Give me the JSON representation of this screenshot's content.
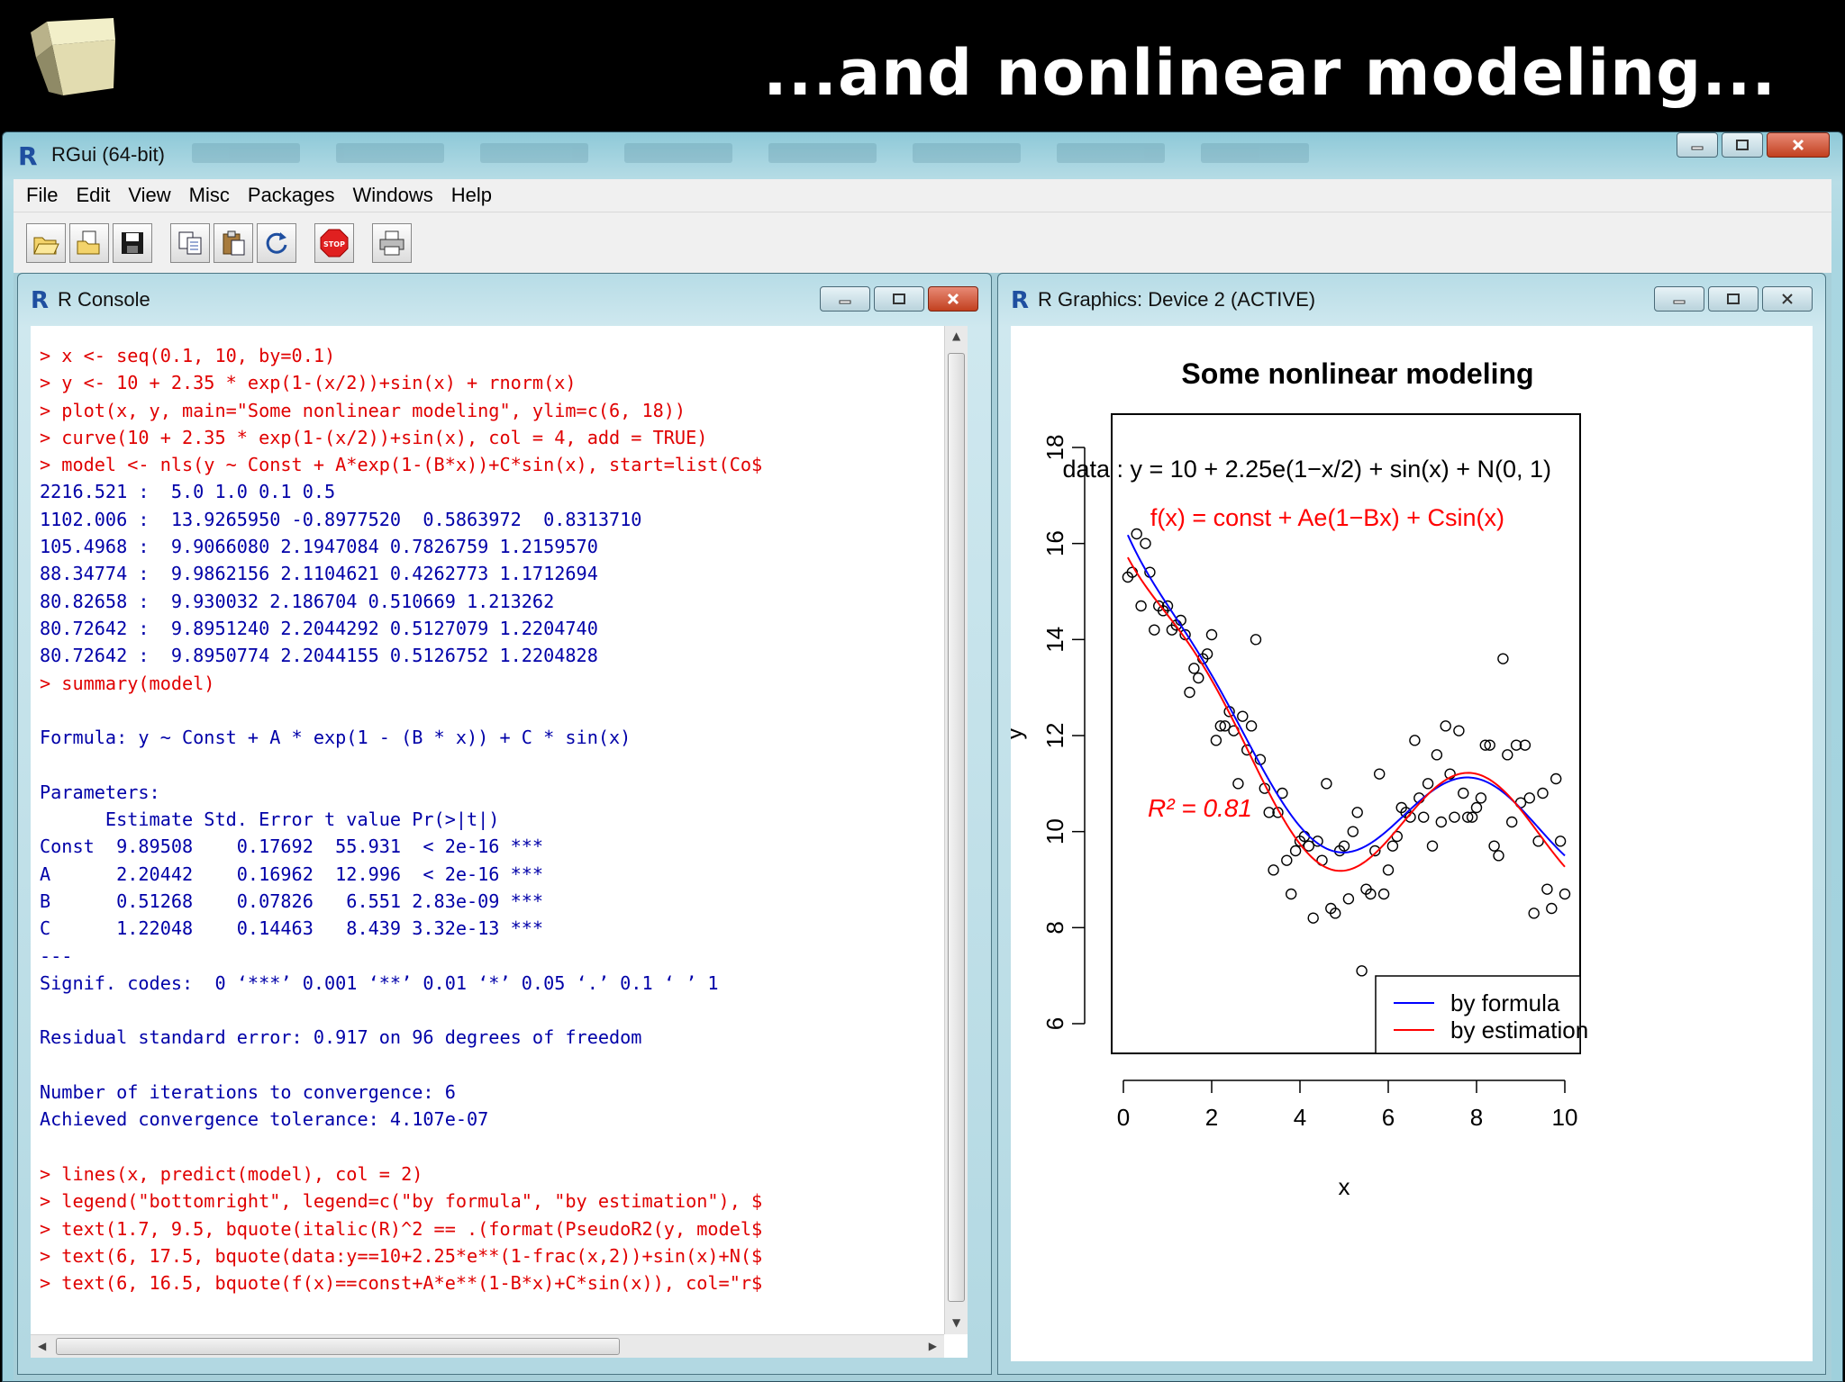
{
  "slide": {
    "title": "...and nonlinear modeling..."
  },
  "window": {
    "title": "RGui (64-bit)",
    "menu": [
      "File",
      "Edit",
      "View",
      "Misc",
      "Packages",
      "Windows",
      "Help"
    ],
    "toolbar_icons": [
      "open-script-icon",
      "load-workspace-icon",
      "save-icon",
      "copy-icon",
      "paste-icon",
      "refresh-icon",
      "stop-icon",
      "print-icon"
    ],
    "toolbar_stop_label": "STOP"
  },
  "console": {
    "title": "R Console",
    "lines": [
      {
        "kind": "cmd",
        "text": "> x <- seq(0.1, 10, by=0.1)"
      },
      {
        "kind": "cmd",
        "text": "> y <- 10 + 2.35 * exp(1-(x/2))+sin(x) + rnorm(x)"
      },
      {
        "kind": "cmd",
        "text": "> plot(x, y, main=\"Some nonlinear modeling\", ylim=c(6, 18))"
      },
      {
        "kind": "cmd",
        "text": "> curve(10 + 2.35 * exp(1-(x/2))+sin(x), col = 4, add = TRUE)"
      },
      {
        "kind": "cmd",
        "text": "> model <- nls(y ~ Const + A*exp(1-(B*x))+C*sin(x), start=list(Co$"
      },
      {
        "kind": "out",
        "text": "2216.521 :  5.0 1.0 0.1 0.5"
      },
      {
        "kind": "out",
        "text": "1102.006 :  13.9265950 -0.8977520  0.5863972  0.8313710"
      },
      {
        "kind": "out",
        "text": "105.4968 :  9.9066080 2.1947084 0.7826759 1.2159570"
      },
      {
        "kind": "out",
        "text": "88.34774 :  9.9862156 2.1104621 0.4262773 1.1712694"
      },
      {
        "kind": "out",
        "text": "80.82658 :  9.930032 2.186704 0.510669 1.213262"
      },
      {
        "kind": "out",
        "text": "80.72642 :  9.8951240 2.2044292 0.5127079 1.2204740"
      },
      {
        "kind": "out",
        "text": "80.72642 :  9.8950774 2.2044155 0.5126752 1.2204828"
      },
      {
        "kind": "cmd",
        "text": "> summary(model)"
      },
      {
        "kind": "out",
        "text": ""
      },
      {
        "kind": "out",
        "text": "Formula: y ~ Const + A * exp(1 - (B * x)) + C * sin(x)"
      },
      {
        "kind": "out",
        "text": ""
      },
      {
        "kind": "out",
        "text": "Parameters:"
      },
      {
        "kind": "out",
        "text": "      Estimate Std. Error t value Pr(>|t|)    "
      },
      {
        "kind": "out",
        "text": "Const  9.89508    0.17692  55.931  < 2e-16 ***"
      },
      {
        "kind": "out",
        "text": "A      2.20442    0.16962  12.996  < 2e-16 ***"
      },
      {
        "kind": "out",
        "text": "B      0.51268    0.07826   6.551 2.83e-09 ***"
      },
      {
        "kind": "out",
        "text": "C      1.22048    0.14463   8.439 3.32e-13 ***"
      },
      {
        "kind": "out",
        "text": "---"
      },
      {
        "kind": "out",
        "text": "Signif. codes:  0 ‘***’ 0.001 ‘**’ 0.01 ‘*’ 0.05 ‘.’ 0.1 ‘ ’ 1"
      },
      {
        "kind": "out",
        "text": ""
      },
      {
        "kind": "out",
        "text": "Residual standard error: 0.917 on 96 degrees of freedom"
      },
      {
        "kind": "out",
        "text": ""
      },
      {
        "kind": "out",
        "text": "Number of iterations to convergence: 6 "
      },
      {
        "kind": "out",
        "text": "Achieved convergence tolerance: 4.107e-07 "
      },
      {
        "kind": "out",
        "text": ""
      },
      {
        "kind": "cmd",
        "text": "> lines(x, predict(model), col = 2)"
      },
      {
        "kind": "cmd",
        "text": "> legend(\"bottomright\", legend=c(\"by formula\", \"by estimation\"), $"
      },
      {
        "kind": "cmd",
        "text": "> text(1.7, 9.5, bquote(italic(R)^2 == .(format(PseudoR2(y, model$"
      },
      {
        "kind": "cmd",
        "text": "> text(6, 17.5, bquote(data:y==10+2.25*e**(1-frac(x,2))+sin(x)+N($"
      },
      {
        "kind": "cmd",
        "text": "> text(6, 16.5, bquote(f(x)==const+A*e**(1-B*x)+C*sin(x)), col=\"r$"
      }
    ]
  },
  "graphics": {
    "title": "R Graphics: Device 2 (ACTIVE)"
  },
  "chart_data": {
    "type": "scatter",
    "title": "Some nonlinear modeling",
    "xlabel": "x",
    "ylabel": "y",
    "xlim": [
      0,
      10
    ],
    "ylim": [
      6,
      18
    ],
    "xticks": [
      "0",
      "2",
      "4",
      "6",
      "8",
      "10"
    ],
    "yticks": [
      "6",
      "8",
      "10",
      "12",
      "14",
      "16",
      "18"
    ],
    "points": [
      [
        0.1,
        15.3
      ],
      [
        0.2,
        15.4
      ],
      [
        0.3,
        16.2
      ],
      [
        0.4,
        14.7
      ],
      [
        0.5,
        16.0
      ],
      [
        0.6,
        15.4
      ],
      [
        0.7,
        14.2
      ],
      [
        0.8,
        14.7
      ],
      [
        0.9,
        14.6
      ],
      [
        1.0,
        14.7
      ],
      [
        1.1,
        14.2
      ],
      [
        1.2,
        14.3
      ],
      [
        1.3,
        14.4
      ],
      [
        1.4,
        14.1
      ],
      [
        1.5,
        12.9
      ],
      [
        1.6,
        13.4
      ],
      [
        1.7,
        13.2
      ],
      [
        1.8,
        13.6
      ],
      [
        1.9,
        13.7
      ],
      [
        2.0,
        14.1
      ],
      [
        2.1,
        11.9
      ],
      [
        2.2,
        12.2
      ],
      [
        2.3,
        12.2
      ],
      [
        2.4,
        12.5
      ],
      [
        2.5,
        12.1
      ],
      [
        2.6,
        11.0
      ],
      [
        2.7,
        12.4
      ],
      [
        2.8,
        11.7
      ],
      [
        2.9,
        12.2
      ],
      [
        3.0,
        14.0
      ],
      [
        3.1,
        11.5
      ],
      [
        3.2,
        10.9
      ],
      [
        3.3,
        10.4
      ],
      [
        3.4,
        9.2
      ],
      [
        3.5,
        10.4
      ],
      [
        3.6,
        10.8
      ],
      [
        3.7,
        9.4
      ],
      [
        3.8,
        8.7
      ],
      [
        3.9,
        9.6
      ],
      [
        4.0,
        9.8
      ],
      [
        4.1,
        9.9
      ],
      [
        4.2,
        9.7
      ],
      [
        4.3,
        8.2
      ],
      [
        4.4,
        9.8
      ],
      [
        4.5,
        9.4
      ],
      [
        4.6,
        11.0
      ],
      [
        4.7,
        8.4
      ],
      [
        4.8,
        8.3
      ],
      [
        4.9,
        9.6
      ],
      [
        5.0,
        9.7
      ],
      [
        5.1,
        8.6
      ],
      [
        5.2,
        10.0
      ],
      [
        5.3,
        10.4
      ],
      [
        5.4,
        7.1
      ],
      [
        5.5,
        8.8
      ],
      [
        5.6,
        8.7
      ],
      [
        5.7,
        9.6
      ],
      [
        5.8,
        11.2
      ],
      [
        5.9,
        8.7
      ],
      [
        6.0,
        9.2
      ],
      [
        6.1,
        9.7
      ],
      [
        6.2,
        9.9
      ],
      [
        6.3,
        10.5
      ],
      [
        6.4,
        10.4
      ],
      [
        6.5,
        10.3
      ],
      [
        6.6,
        11.9
      ],
      [
        6.7,
        10.7
      ],
      [
        6.8,
        10.3
      ],
      [
        6.9,
        11.0
      ],
      [
        7.0,
        9.7
      ],
      [
        7.1,
        11.6
      ],
      [
        7.2,
        10.2
      ],
      [
        7.3,
        12.2
      ],
      [
        7.4,
        11.2
      ],
      [
        7.5,
        10.3
      ],
      [
        7.6,
        12.1
      ],
      [
        7.7,
        10.8
      ],
      [
        7.8,
        10.3
      ],
      [
        7.9,
        10.3
      ],
      [
        8.0,
        10.5
      ],
      [
        8.1,
        10.7
      ],
      [
        8.2,
        11.8
      ],
      [
        8.3,
        11.8
      ],
      [
        8.4,
        9.7
      ],
      [
        8.5,
        9.5
      ],
      [
        8.6,
        13.6
      ],
      [
        8.7,
        11.6
      ],
      [
        8.8,
        10.2
      ],
      [
        8.9,
        11.8
      ],
      [
        9.0,
        10.6
      ],
      [
        9.1,
        11.8
      ],
      [
        9.2,
        10.7
      ],
      [
        9.3,
        8.3
      ],
      [
        9.4,
        9.8
      ],
      [
        9.5,
        10.8
      ],
      [
        9.6,
        8.8
      ],
      [
        9.7,
        8.4
      ],
      [
        9.8,
        11.1
      ],
      [
        9.9,
        9.8
      ],
      [
        10.0,
        8.7
      ]
    ],
    "series": [
      {
        "name": "by formula",
        "color": "#0000ff",
        "formula": "10 + 2.35*exp(1-x/2) + sin(x)"
      },
      {
        "name": "by estimation",
        "color": "#ff0000",
        "formula": "9.89508 + 2.20442*exp(1-0.51268*x) + 1.22048*sin(x)"
      }
    ],
    "annotations": {
      "data_eq": "data : y = 10 + 2.25e(1−x/2) + sin(x) + N(0, 1)",
      "f_eq": "f(x) = const + Ae(1−Bx) + Csin(x)",
      "r2": "R² = 0.81"
    },
    "legend_position": "bottom-right",
    "grid": false
  }
}
